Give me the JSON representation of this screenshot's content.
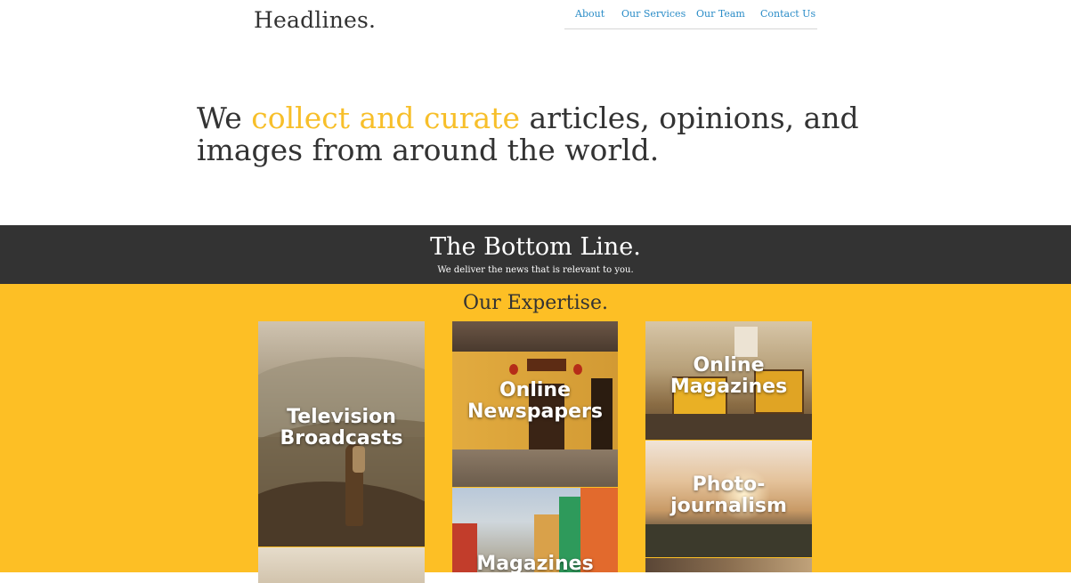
{
  "header": {
    "logo": "Headlines.",
    "nav": [
      "About",
      "Our Services",
      "Our Team",
      "Contact Us"
    ],
    "tagline_prefix": "We ",
    "tagline_highlight": "collect and curate",
    "tagline_suffix": " articles, opinions, and images from around the world."
  },
  "band": {
    "title": "The Bottom Line.",
    "subtitle": "We deliver the news that is relevant to you."
  },
  "expertise": {
    "title": "Our Expertise.",
    "tiles": [
      {
        "label": "Television Broadcasts"
      },
      {
        "label": "Online Newspapers"
      },
      {
        "label": "Magazines"
      },
      {
        "label": "Online Magazines"
      },
      {
        "label": "Photo-journalism"
      }
    ]
  },
  "colors": {
    "accent": "#f7bf2a",
    "band": "#333333",
    "expertise_bg": "#fdbf25",
    "link": "#2a8cc7"
  }
}
